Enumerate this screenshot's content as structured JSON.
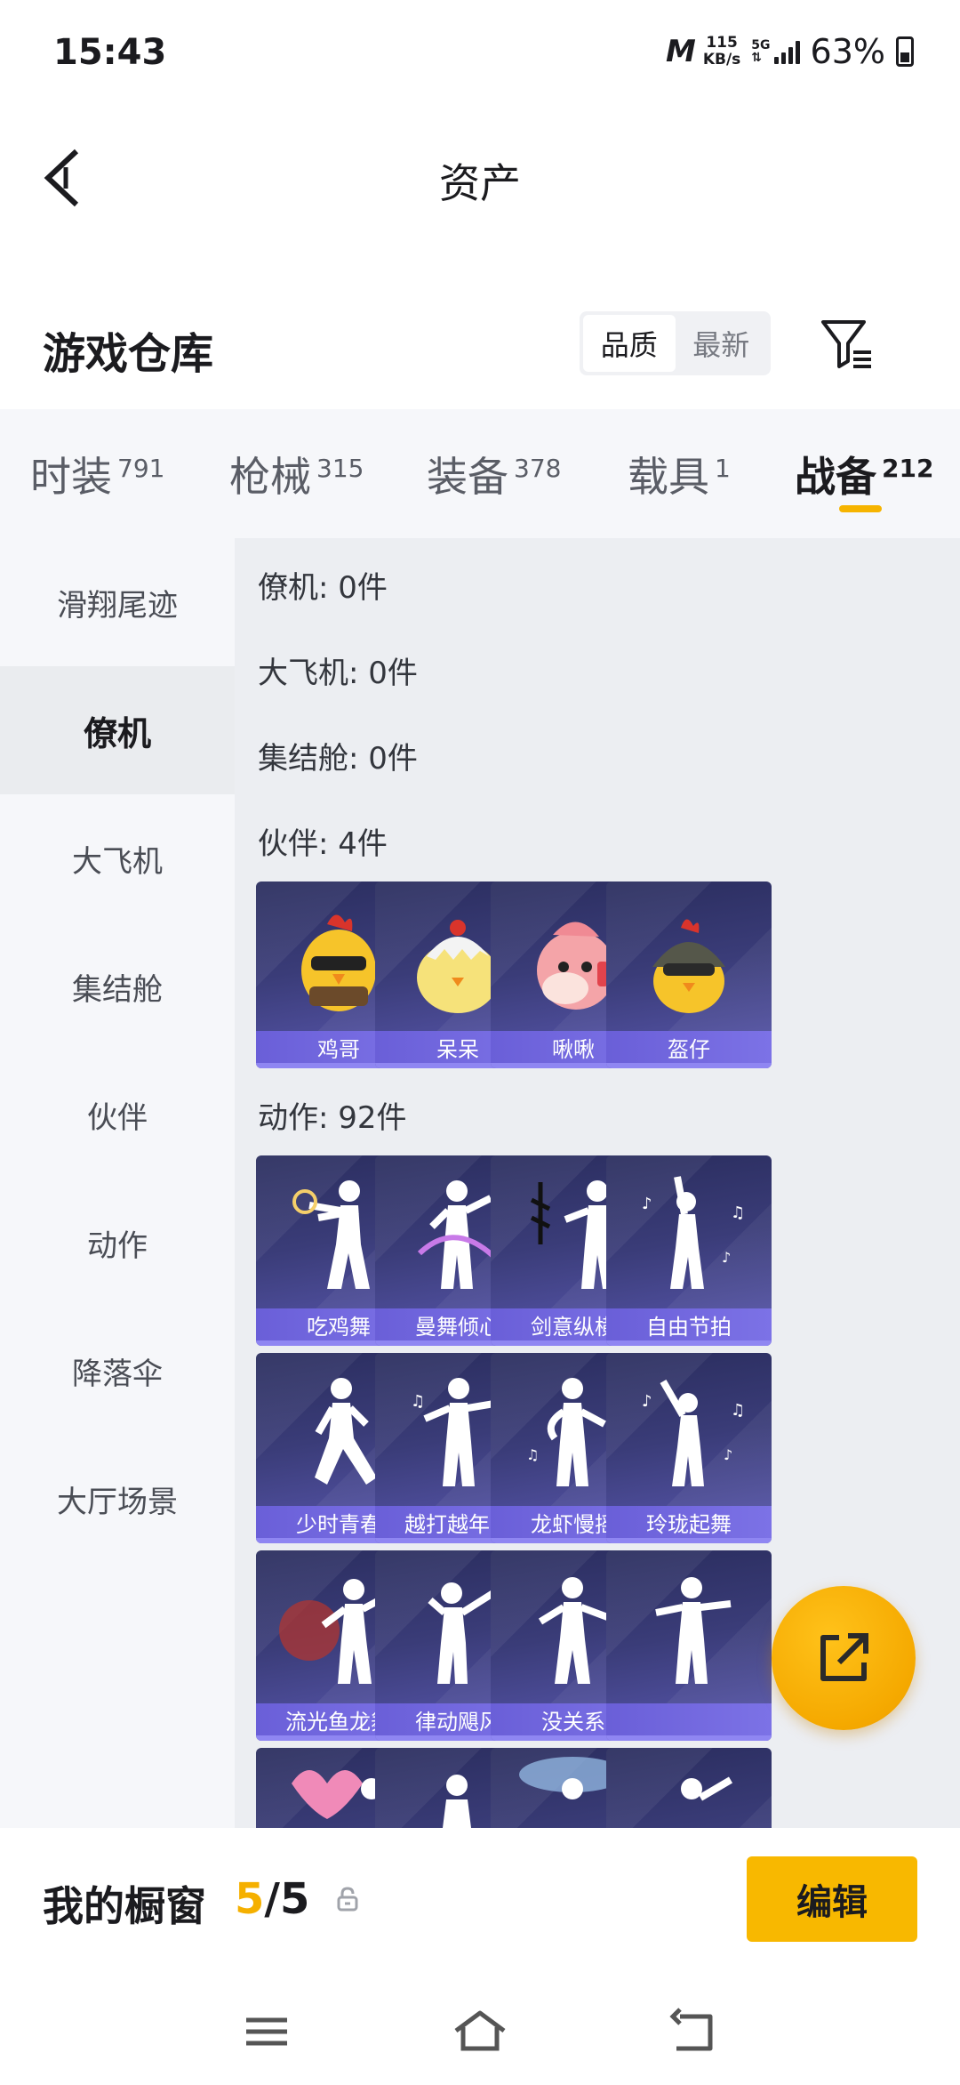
{
  "status_bar": {
    "time": "15:43",
    "net_speed_value": "115",
    "net_speed_unit": "KB/s",
    "network_type": "5G",
    "battery_percent": "63%",
    "net_logo": "M"
  },
  "header": {
    "title": "资产",
    "back_icon": "chevron-left-icon"
  },
  "warehouse": {
    "title": "游戏仓库",
    "sort_options": [
      "品质",
      "最新"
    ],
    "sort_selected": "品质",
    "filter_icon": "filter-list-icon"
  },
  "tabs": [
    {
      "label": "时装",
      "count": "791",
      "active": false
    },
    {
      "label": "枪械",
      "count": "315",
      "active": false
    },
    {
      "label": "装备",
      "count": "378",
      "active": false
    },
    {
      "label": "载具",
      "count": "1",
      "active": false
    },
    {
      "label": "战备",
      "count": "212",
      "active": true
    }
  ],
  "sidebar": {
    "items": [
      {
        "label": "滑翔尾迹",
        "active": false
      },
      {
        "label": "僚机",
        "active": true
      },
      {
        "label": "大飞机",
        "active": false
      },
      {
        "label": "集结舱",
        "active": false
      },
      {
        "label": "伙伴",
        "active": false
      },
      {
        "label": "动作",
        "active": false
      },
      {
        "label": "降落伞",
        "active": false
      },
      {
        "label": "大厅场景",
        "active": false
      }
    ]
  },
  "content": {
    "sections": [
      {
        "label": "僚机: 0件"
      },
      {
        "label": "大飞机: 0件"
      },
      {
        "label": "集结舱: 0件"
      },
      {
        "label": "伙伴: 4件"
      },
      {
        "label": "动作: 92件"
      }
    ],
    "partners": [
      "鸡哥",
      "呆呆",
      "啾啾",
      "盔仔"
    ],
    "emotes": [
      "吃鸡舞",
      "曼舞倾心",
      "剑意纵横",
      "自由节拍",
      "少时青春",
      "越打越年轻",
      "龙虾慢摇",
      "玲珑起舞",
      "流光鱼龙舞",
      "律动飓风",
      "没关系",
      ""
    ]
  },
  "fab": {
    "icon": "share-external-icon"
  },
  "showcase": {
    "title": "我的橱窗",
    "current": "5",
    "separator": "/",
    "total": "5",
    "lock_icon": "lock-icon",
    "edit_label": "编辑"
  },
  "nav": {
    "menu_icon": "menu-icon",
    "home_icon": "home-icon",
    "back_icon": "back-icon"
  },
  "colors": {
    "accent": "#f6b400",
    "card_top": "#2a2d5e",
    "card_label": "#6a5fd8"
  }
}
